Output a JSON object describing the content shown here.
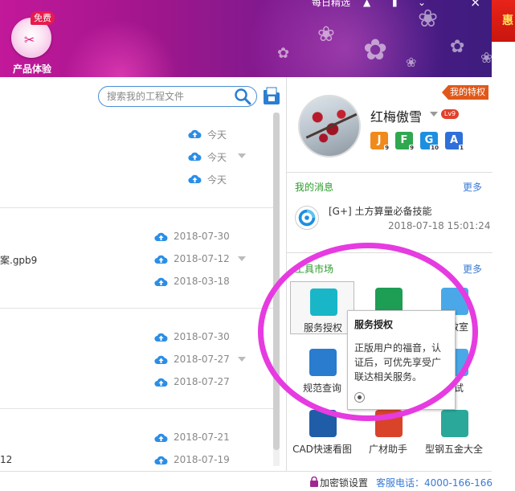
{
  "header": {
    "top_text": "每日精选",
    "product_badge": {
      "label": "产品体验",
      "tag": "免费"
    },
    "promo_text": "惠"
  },
  "file_panel": {
    "search_placeholder": "搜索我的工程文件",
    "groups": [
      {
        "rows": [
          {
            "name": "",
            "date": "今天",
            "has_caret": false
          },
          {
            "name": "",
            "date": "今天",
            "has_caret": true
          },
          {
            "name": "",
            "date": "今天",
            "has_caret": false
          }
        ]
      },
      {
        "rows": [
          {
            "name": "",
            "date": "2018-07-30",
            "has_caret": false
          },
          {
            "name": "案.gpb9",
            "date": "2018-07-12",
            "has_caret": true
          },
          {
            "name": "",
            "date": "2018-03-18",
            "has_caret": false
          }
        ]
      },
      {
        "rows": [
          {
            "name": "",
            "date": "2018-07-30",
            "has_caret": false
          },
          {
            "name": "",
            "date": "2018-07-27",
            "has_caret": true
          },
          {
            "name": "",
            "date": "2018-07-27",
            "has_caret": false
          }
        ]
      },
      {
        "rows": [
          {
            "name": "",
            "date": "2018-07-21",
            "has_caret": false
          },
          {
            "name": "12",
            "date": "2018-07-19",
            "has_caret": false
          }
        ]
      }
    ]
  },
  "right_panel": {
    "privilege_tag": "我的特权",
    "user": {
      "name": "红梅傲雪",
      "level": "Lv9",
      "apps": [
        {
          "letter": "J",
          "sup": "9",
          "color": "#f08a1c"
        },
        {
          "letter": "F",
          "sup": "9",
          "color": "#2fa84f"
        },
        {
          "letter": "G",
          "sup": "10",
          "color": "#1e8fe0"
        },
        {
          "letter": "A",
          "sup": "1",
          "color": "#2f6fd8"
        }
      ]
    },
    "messages": {
      "title": "我的消息",
      "more": "更多",
      "items": [
        {
          "text": "[G+] 土方算量必备技能",
          "time": "2018-07-18 15:01:24"
        }
      ]
    },
    "tools": {
      "title": "工具市场",
      "more": "更多",
      "items": [
        {
          "label": "服务授权",
          "icon": "service-auth-icon",
          "color": "#19b6c8",
          "selected": true
        },
        {
          "label": "",
          "icon": "green-doc-icon",
          "color": "#1e9d55",
          "selected": false
        },
        {
          "label": "法教室",
          "icon": "book-icon",
          "color": "#4aa8e8",
          "selected": false
        },
        {
          "label": "规范查询",
          "icon": "spec-query-icon",
          "color": "#2a7ccf",
          "selected": false
        },
        {
          "label": "",
          "icon": "hidden-icon",
          "color": "#cccccc",
          "selected": false
        },
        {
          "label": "考试",
          "icon": "exam-icon",
          "color": "#4aa8e8",
          "selected": false
        },
        {
          "label": "CAD快速看图",
          "icon": "cad-icon",
          "color": "#1f5da8",
          "selected": false
        },
        {
          "label": "广材助手",
          "icon": "material-helper-icon",
          "color": "#d8432a",
          "selected": false
        },
        {
          "label": "型钢五金大全",
          "icon": "steel-icon",
          "color": "#2aa89a",
          "selected": false
        }
      ]
    }
  },
  "tooltip": {
    "title": "服务授权",
    "body": "正版用户的福音，认证后，可优先享受广联达相关服务。"
  },
  "footer": {
    "lock_label": "加密锁设置",
    "hotline": "客服电话：4000-166-166"
  }
}
